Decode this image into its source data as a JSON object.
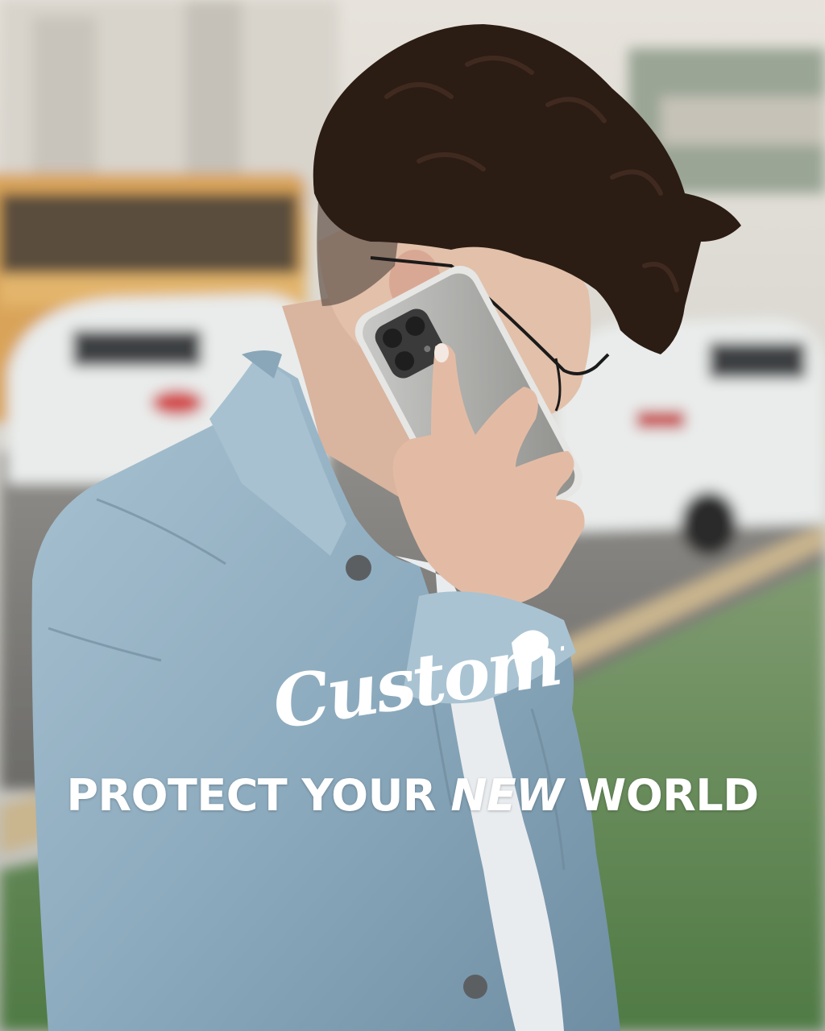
{
  "brand": {
    "logo_text": "Customic"
  },
  "tagline": {
    "part1": "PROTECT YOUR ",
    "emphasis": "NEW",
    "part2": " WORLD"
  },
  "colors": {
    "text": "#ffffff",
    "denim": "#8fb3c9",
    "grass": "#5f8a52",
    "hair": "#2b1c14",
    "bus": "#d9a45a",
    "car": "#e9eceb"
  },
  "scene": {
    "subject": "person-on-phone",
    "icons": [
      "phone-icon",
      "glasses-icon"
    ]
  }
}
